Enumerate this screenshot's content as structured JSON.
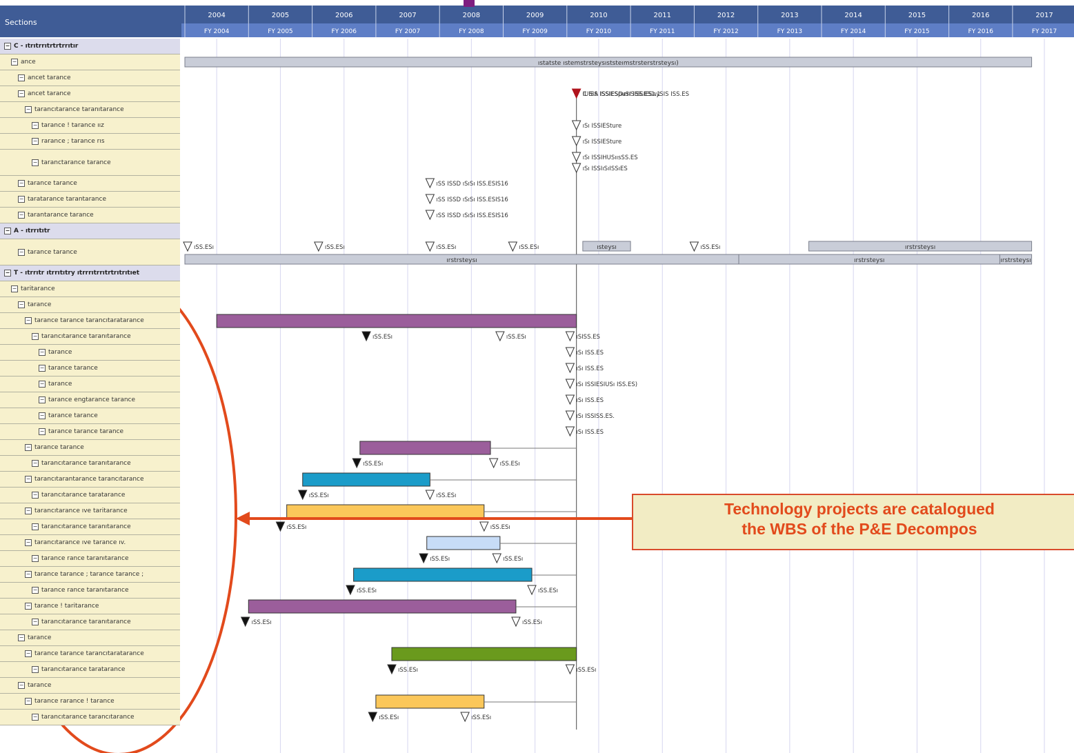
{
  "header": {
    "sections_label": "Sections",
    "years": [
      "2004",
      "2005",
      "2006",
      "2007",
      "2008",
      "2009",
      "2010",
      "2011",
      "2012",
      "2013",
      "2014",
      "2015",
      "2016",
      "2017"
    ],
    "fiscal_years": [
      "FY 2004",
      "FY 2005",
      "FY 2006",
      "FY 2007",
      "FY 2008",
      "FY 2009",
      "FY 2010",
      "FY 2011",
      "FY 2012",
      "FY 2013",
      "FY 2014",
      "FY 2015",
      "FY 2016",
      "FY 2017"
    ]
  },
  "rows": [
    {
      "label": "C - ıtrıtrrıtrtrtrrıtır",
      "type": "section",
      "indent": 0
    },
    {
      "label": "ance",
      "indent": 1
    },
    {
      "label": "ancet tarance",
      "indent": 2
    },
    {
      "label": "ancet tarance",
      "indent": 2
    },
    {
      "label": "tarancıtarance taranıtarance",
      "indent": 3
    },
    {
      "label": "tarance ! tarance ıız",
      "indent": 4
    },
    {
      "label": "rarance ; tarance rıs",
      "indent": 4
    },
    {
      "label": "taranctarance tarance",
      "indent": 4,
      "tall": true
    },
    {
      "label": "tarance tarance",
      "indent": 2
    },
    {
      "label": "taratarance tarantarance",
      "indent": 2
    },
    {
      "label": "tarantarance tarance",
      "indent": 2
    },
    {
      "label": "A - ıtrrıtıtr",
      "type": "section",
      "indent": 0
    },
    {
      "label": "tarance tarance",
      "indent": 2,
      "tall": true
    },
    {
      "label": "T - ıtrrıtr ıtrrıtıtry ıtrrrıtrrıtrtrıtrıtıet",
      "type": "section",
      "indent": 0
    },
    {
      "label": "taritarance",
      "indent": 1
    },
    {
      "label": "tarance",
      "indent": 2
    },
    {
      "label": "tarance tarance tarancıtaratarance",
      "indent": 3
    },
    {
      "label": "tarancıtarance taranıtarance",
      "indent": 4
    },
    {
      "label": "tarance",
      "indent": 5
    },
    {
      "label": "tarance tarance",
      "indent": 5
    },
    {
      "label": "tarance",
      "indent": 5
    },
    {
      "label": "tarance engtarance tarance",
      "indent": 5
    },
    {
      "label": "tarance tarance",
      "indent": 5
    },
    {
      "label": "tarance tarance tarance",
      "indent": 5
    },
    {
      "label": "tarance tarance",
      "indent": 3
    },
    {
      "label": "tarancıtarance taranıtarance",
      "indent": 4
    },
    {
      "label": "tarancıtarantarance tarancıtarance",
      "indent": 3
    },
    {
      "label": "tarancıtarance taratarance",
      "indent": 4
    },
    {
      "label": "tarancıtarance ıve taritarance",
      "indent": 3
    },
    {
      "label": "tarancıtarance taranıtarance",
      "indent": 4
    },
    {
      "label": "tarancıtarance ıve tarance ıv.",
      "indent": 3
    },
    {
      "label": "tarance rance taranıtarance",
      "indent": 4
    },
    {
      "label": "tarance tarance ; tarance tarance ;",
      "indent": 3
    },
    {
      "label": "tarance rance taranıtarance",
      "indent": 4
    },
    {
      "label": "tarance ! taritarance",
      "indent": 3
    },
    {
      "label": "tarancıtarance taranıtarance",
      "indent": 4
    },
    {
      "label": "tarance",
      "indent": 2
    },
    {
      "label": "tarance tarance tarancıtaratarance",
      "indent": 3
    },
    {
      "label": "tarancıtarance taratarance",
      "indent": 4
    },
    {
      "label": "tarance",
      "indent": 2
    },
    {
      "label": "tarance rarance ! tarance",
      "indent": 3
    },
    {
      "label": "tarancıtarance tarancıtarance",
      "indent": 4
    }
  ],
  "summary_bars": [
    {
      "row": 1,
      "start": 2004.0,
      "end": 2017.3,
      "label": "ıstatste ıstemstrsteysıststeımstrsterstrsteysı)"
    },
    {
      "row": 12,
      "start": 2004.0,
      "end": 2012.7,
      "label": "ırstrsteysı",
      "line": 2
    },
    {
      "row": 12,
      "start": 2012.7,
      "end": 2016.8,
      "label": "ırstrsteysı",
      "line": 2
    },
    {
      "row": 12,
      "start": 2016.8,
      "end": 2017.3,
      "label": "ırstrsteysı",
      "line": 2
    },
    {
      "row": 12,
      "start": 2010.25,
      "end": 2011.0,
      "label": "ısteysı",
      "line": 1
    },
    {
      "row": 12,
      "start": 2013.8,
      "end": 2017.3,
      "label": "ırstrsteysı",
      "line": 1
    }
  ],
  "bars": [
    {
      "row": 16,
      "start": 2004.5,
      "end": 2010.15,
      "color": "#9b5e9b"
    },
    {
      "row": 24,
      "start": 2006.75,
      "end": 2008.8,
      "color": "#9b5e9b"
    },
    {
      "row": 26,
      "start": 2005.85,
      "end": 2007.85,
      "color": "#1b9cc9"
    },
    {
      "row": 28,
      "start": 2005.6,
      "end": 2008.7,
      "color": "#fbc75a"
    },
    {
      "row": 30,
      "start": 2007.8,
      "end": 2008.95,
      "color": "#c7dcf7"
    },
    {
      "row": 32,
      "start": 2006.65,
      "end": 2009.45,
      "color": "#1b9cc9"
    },
    {
      "row": 34,
      "start": 2005.0,
      "end": 2009.2,
      "color": "#9b5e9b"
    },
    {
      "row": 37,
      "start": 2007.25,
      "end": 2010.15,
      "color": "#6a9a1d"
    },
    {
      "row": 40,
      "start": 2007.0,
      "end": 2008.7,
      "color": "#fbc75a"
    }
  ],
  "milestones": [
    {
      "row": 3,
      "x": 2010.15,
      "filled": true,
      "red": true,
      "label": "C ISA ISSIESDerıSISSIESaySIS ISS.ES",
      "line": 0
    },
    {
      "row": 3,
      "x": 2010.15,
      "filled": true,
      "red": true,
      "label": "IUSIS ISSIESpuSI ISS.ES1.1",
      "line": 1
    },
    {
      "row": 5,
      "x": 2010.15,
      "filled": false,
      "label": "ıSı ISSIESture"
    },
    {
      "row": 6,
      "x": 2010.15,
      "filled": false,
      "label": "ıSı ISSIESture"
    },
    {
      "row": 7,
      "x": 2010.15,
      "filled": false,
      "label": "ıSı ISSIHUSıısSS.ES",
      "line": 0
    },
    {
      "row": 7,
      "x": 2010.15,
      "filled": false,
      "label": "ıSı ISSIıSıISSıES",
      "line": 1
    },
    {
      "row": 8,
      "x": 2007.85,
      "filled": false,
      "label": "ıSS ISSD ıSıSı ISS.ESIS16"
    },
    {
      "row": 9,
      "x": 2007.85,
      "filled": false,
      "label": "ıSS ISSD ıSıSı ISS.ESIS16"
    },
    {
      "row": 10,
      "x": 2007.85,
      "filled": false,
      "label": "ıSS ISSD ıSıSı ISS.ESIS16"
    },
    {
      "row": 12,
      "x": 2004.0,
      "filled": false,
      "label": "ıSS.ESı",
      "line": 0
    },
    {
      "row": 12,
      "x": 2006.1,
      "filled": false,
      "label": "ıSS.ESı",
      "line": 0
    },
    {
      "row": 12,
      "x": 2007.85,
      "filled": false,
      "label": "ıSS.ESı",
      "line": 0
    },
    {
      "row": 12,
      "x": 2009.15,
      "filled": false,
      "label": "ıSS.ESı",
      "line": 0
    },
    {
      "row": 12,
      "x": 2012.0,
      "filled": false,
      "label": "ıSS.ESı",
      "line": 0
    },
    {
      "row": 17,
      "x": 2006.85,
      "filled": true,
      "label": "ıSS.ESı"
    },
    {
      "row": 17,
      "x": 2008.95,
      "filled": false,
      "label": "ıSS.ESı"
    },
    {
      "row": 17,
      "x": 2010.05,
      "filled": false,
      "label": "ıSISS.ES"
    },
    {
      "row": 18,
      "x": 2010.05,
      "filled": false,
      "label": "ıSı ISS.ES"
    },
    {
      "row": 19,
      "x": 2010.05,
      "filled": false,
      "label": "ıSı ISS.ES"
    },
    {
      "row": 20,
      "x": 2010.05,
      "filled": false,
      "label": "ıSı ISSIESIUSı ISS.ES)"
    },
    {
      "row": 21,
      "x": 2010.05,
      "filled": false,
      "label": "ıSı ISS.ES"
    },
    {
      "row": 22,
      "x": 2010.05,
      "filled": false,
      "label": "ıSı ISSISS.ES."
    },
    {
      "row": 23,
      "x": 2010.05,
      "filled": false,
      "label": "ıSı ISS.ES"
    },
    {
      "row": 25,
      "x": 2006.7,
      "filled": true,
      "label": "ıSS.ESı"
    },
    {
      "row": 25,
      "x": 2008.85,
      "filled": false,
      "label": "ıSS.ESı"
    },
    {
      "row": 27,
      "x": 2005.85,
      "filled": true,
      "label": "ıSS.ESı"
    },
    {
      "row": 27,
      "x": 2007.85,
      "filled": false,
      "label": "ıSS.ESı"
    },
    {
      "row": 29,
      "x": 2005.5,
      "filled": true,
      "label": "ıSS.ESı"
    },
    {
      "row": 29,
      "x": 2008.7,
      "filled": false,
      "label": "ıSS.ESı"
    },
    {
      "row": 31,
      "x": 2007.75,
      "filled": true,
      "label": "ıSS.ESı"
    },
    {
      "row": 31,
      "x": 2008.9,
      "filled": false,
      "label": "ıSS.ESı"
    },
    {
      "row": 33,
      "x": 2006.6,
      "filled": true,
      "label": "ıSS.ESı"
    },
    {
      "row": 33,
      "x": 2009.45,
      "filled": false,
      "label": "ıSS.ESı"
    },
    {
      "row": 35,
      "x": 2004.95,
      "filled": true,
      "label": "ıSS.ESı"
    },
    {
      "row": 35,
      "x": 2009.2,
      "filled": false,
      "label": "ıSS.ESı"
    },
    {
      "row": 38,
      "x": 2007.25,
      "filled": true,
      "label": "ıSS.ESı"
    },
    {
      "row": 38,
      "x": 2010.05,
      "filled": false,
      "label": "ıSS.ESı"
    },
    {
      "row": 41,
      "x": 2006.95,
      "filled": true,
      "label": "ıSS.ESı"
    },
    {
      "row": 41,
      "x": 2008.4,
      "filled": false,
      "label": "ıSS.ESı"
    }
  ],
  "status_line_x": 2010.15,
  "callout": {
    "line1": "Technology projects are catalogued",
    "line2": "the WBS of the P&E Decompos"
  },
  "colors": {
    "header_bg": "#3f5c96",
    "fy_bg": "#5e7ec6",
    "row_label_bg": "#f7f1cd",
    "annotation_red": "#e24a1c",
    "milestone_red": "#b0131c"
  }
}
